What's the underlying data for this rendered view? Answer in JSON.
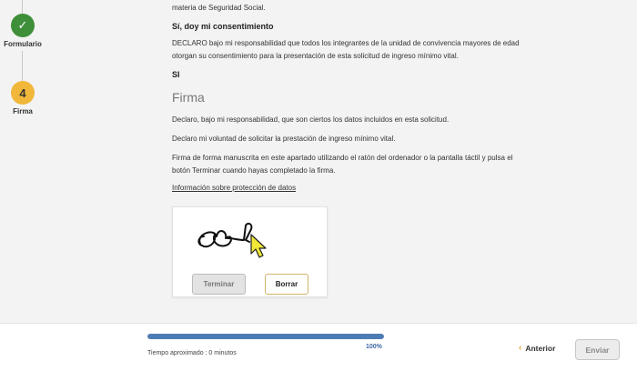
{
  "stepper": {
    "steps": [
      {
        "label": "Formulario",
        "state": "done",
        "symbol": "✓"
      },
      {
        "label": "Firma",
        "state": "current",
        "symbol": "4"
      }
    ]
  },
  "content": {
    "top_fragment": "materia de Seguridad Social.",
    "consent_heading": "Sí, doy mi consentimiento",
    "declaration": "DECLARO bajo mi responsabilidad que todos los integrantes de la unidad de convivencia mayores de edad otorgan su consentimiento para la presentación de esta solicitud de ingreso mínimo vital.",
    "answer": "SI",
    "firma_heading": "Firma",
    "p1": "Declaro, bajo mi responsabilidad, que son ciertos los datos incluidos en esta solicitud.",
    "p2": "Declaro mi voluntad de solicitar la prestación de ingreso mínimo vital.",
    "p3": "Firma de forma manuscrita en este apartado utilizando el ratón del ordenador o la pantalla táctil y pulsa el botón Terminar cuando hayas completado la firma.",
    "link": "Información sobre protección de datos"
  },
  "signature": {
    "terminar_label": "Terminar",
    "borrar_label": "Borrar"
  },
  "footer": {
    "progress_percent": 100,
    "progress_label": "100%",
    "time_label": "Tiempo aproximado : 0 minutos",
    "anterior_label": "Anterior",
    "enviar_label": "Enviar"
  },
  "colors": {
    "done": "#3f8f3a",
    "current": "#f1b73a",
    "progress": "#4d7bb5",
    "accent": "#e0a63a"
  },
  "icons": {
    "step_done": "check-icon",
    "anterior": "chevron-left-icon",
    "cursor": "mouse-pointer-icon"
  }
}
